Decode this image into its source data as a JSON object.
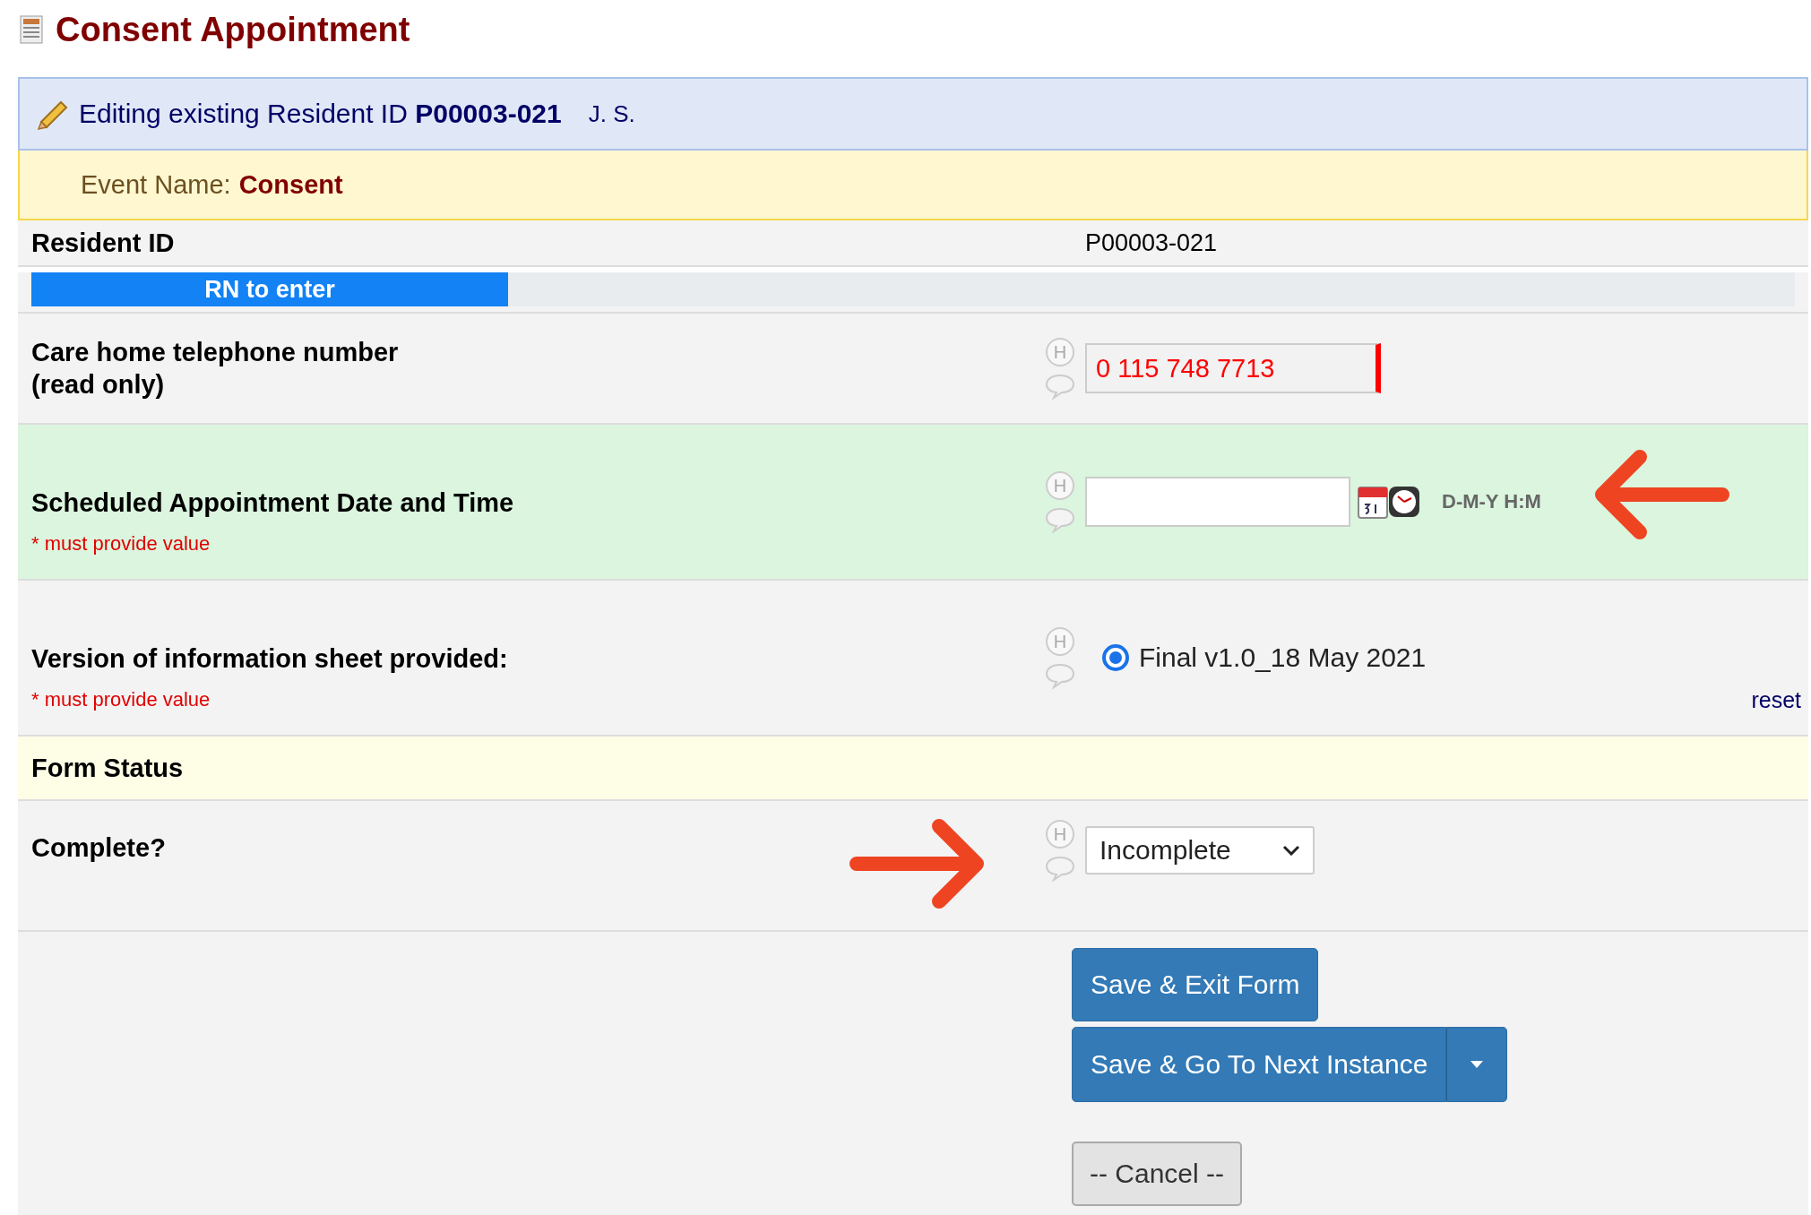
{
  "title": "Consent Appointment",
  "editing_banner": {
    "text": "Editing existing Resident ID **P00003-021**",
    "initials": "J. S."
  },
  "event": {
    "label": "Event Name:",
    "value": "Consent"
  },
  "rows": [
    {
      "kind": "static",
      "label": "Resident ID",
      "value": "P00003-021"
    },
    {
      "kind": "section",
      "label": "RN to enter"
    },
    {
      "kind": "text",
      "label": "Care home telephone number",
      "label_note": "(read only)",
      "value": "0 115 748 7713",
      "read_only": true,
      "history": "H"
    },
    {
      "kind": "datetime",
      "label": "Scheduled Appointment Date and Time",
      "required_note": "* must provide value",
      "format": "D-M-Y H:M",
      "highlighted": true,
      "history": "H",
      "annotation": {
        "kind": "arrow_left"
      }
    },
    {
      "kind": "radio",
      "label": "Version of information sheet provided:",
      "required_note": "* must provide value",
      "options": [
        {
          "label": "Final v1.0_18 May 2021",
          "selected": true
        }
      ],
      "reset": "reset",
      "history": "H"
    },
    {
      "kind": "header",
      "label": "Form Status"
    },
    {
      "kind": "select",
      "label": "Complete?",
      "value": "Incomplete",
      "history": "H",
      "annotation": {
        "kind": "arrow_right"
      }
    }
  ],
  "buttons": {
    "save_exit": "Save & Exit Form",
    "save_next": "Save & Go To Next Instance",
    "cancel": "-- Cancel --"
  }
}
